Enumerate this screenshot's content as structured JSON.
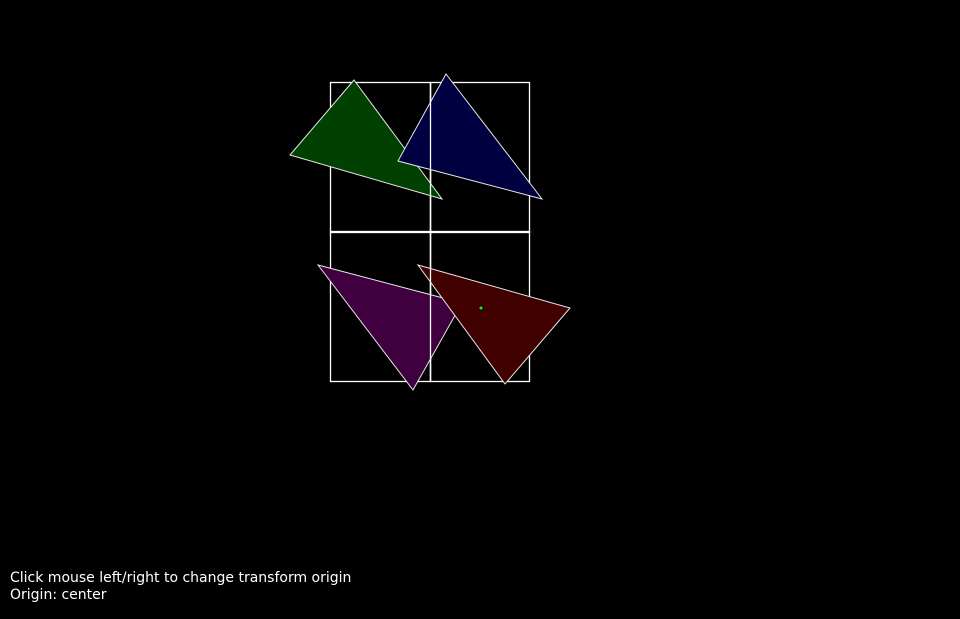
{
  "hud": {
    "instructions": "Click mouse left/right to change transform origin",
    "origin_label": "Origin:",
    "origin_value": "center",
    "origin_text": "Origin: center"
  },
  "scene": {
    "background_color": "#000000",
    "outline_color": "#ffffff",
    "origin_marker_color": "#00ff00",
    "triangles": [
      {
        "name": "green-triangle",
        "fill": "#004000"
      },
      {
        "name": "blue-triangle",
        "fill": "#000040"
      },
      {
        "name": "purple-triangle",
        "fill": "#400040"
      },
      {
        "name": "red-triangle",
        "fill": "#400000"
      }
    ]
  }
}
